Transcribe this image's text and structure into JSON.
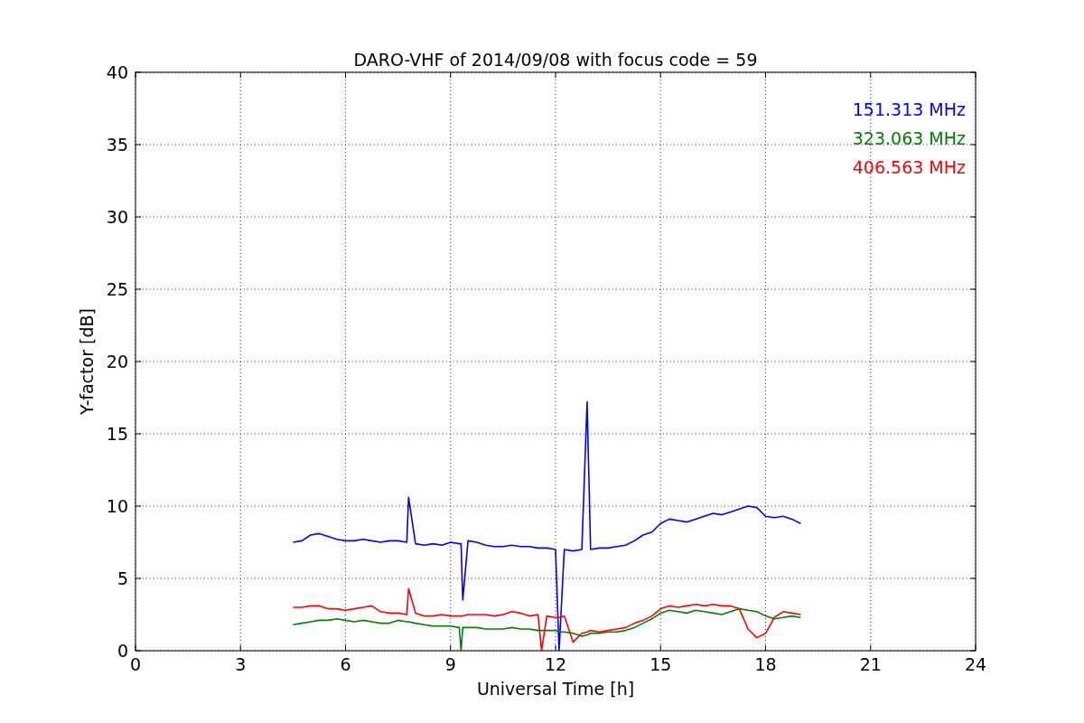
{
  "chart_data": {
    "type": "line",
    "title": "DARO-VHF of 2014/09/08 with focus code = 59",
    "xlabel": "Universal Time [h]",
    "ylabel": "Y-factor [dB]",
    "x": [
      4.5,
      4.75,
      5,
      5.25,
      5.5,
      5.75,
      6,
      6.25,
      6.5,
      6.75,
      7,
      7.25,
      7.5,
      7.75,
      7.8,
      8,
      8.25,
      8.5,
      8.75,
      9,
      9.25,
      9.3,
      9.35,
      9.5,
      9.75,
      10,
      10.25,
      10.5,
      10.75,
      11,
      11.25,
      11.5,
      11.6,
      11.75,
      12,
      12.1,
      12.25,
      12.5,
      12.75,
      12.9,
      13,
      13.25,
      13.5,
      13.75,
      14,
      14.25,
      14.5,
      14.75,
      15,
      15.25,
      15.5,
      15.75,
      16,
      16.25,
      16.5,
      16.75,
      17,
      17.25,
      17.5,
      17.75,
      18,
      18.25,
      18.5,
      18.75,
      19
    ],
    "series": [
      {
        "name": "151.313 MHz",
        "color": "#0000ff",
        "values": [
          7.5,
          7.6,
          8.0,
          8.1,
          7.9,
          7.7,
          7.6,
          7.6,
          7.7,
          7.6,
          7.5,
          7.6,
          7.6,
          7.5,
          10.6,
          7.4,
          7.3,
          7.4,
          7.3,
          7.5,
          7.4,
          7.4,
          3.5,
          7.6,
          7.5,
          7.3,
          7.2,
          7.2,
          7.3,
          7.2,
          7.2,
          7.1,
          7.1,
          7.1,
          7.0,
          0,
          7.0,
          6.9,
          7.0,
          17.2,
          7.0,
          7.1,
          7.1,
          7.2,
          7.3,
          7.6,
          8.0,
          8.2,
          8.8,
          9.1,
          9.0,
          8.9,
          9.1,
          9.3,
          9.5,
          9.4,
          9.6,
          9.8,
          10.0,
          9.9,
          9.3,
          9.2,
          9.3,
          9.1,
          8.8
        ]
      },
      {
        "name": "323.063 MHz",
        "color": "#008000",
        "values": [
          1.8,
          1.9,
          2.0,
          2.1,
          2.1,
          2.2,
          2.1,
          2.0,
          2.1,
          2.0,
          1.9,
          1.9,
          2.1,
          2.0,
          2.0,
          1.9,
          1.8,
          1.7,
          1.7,
          1.7,
          1.6,
          0,
          1.6,
          1.6,
          1.6,
          1.5,
          1.5,
          1.5,
          1.6,
          1.5,
          1.5,
          1.4,
          1.4,
          1.4,
          1.4,
          1.3,
          1.3,
          1.2,
          1.0,
          1.1,
          1.2,
          1.2,
          1.3,
          1.3,
          1.4,
          1.6,
          1.9,
          2.2,
          2.6,
          2.8,
          2.7,
          2.6,
          2.8,
          2.7,
          2.6,
          2.5,
          2.7,
          2.9,
          2.8,
          2.7,
          2.4,
          2.2,
          2.3,
          2.4,
          2.3
        ]
      },
      {
        "name": "406.563 MHz",
        "color": "#ff0000",
        "values": [
          3.0,
          3.0,
          3.1,
          3.1,
          2.9,
          2.9,
          2.8,
          2.9,
          3.0,
          3.1,
          2.7,
          2.6,
          2.6,
          2.5,
          4.3,
          2.6,
          2.4,
          2.4,
          2.5,
          2.4,
          2.4,
          2.4,
          2.4,
          2.5,
          2.5,
          2.5,
          2.4,
          2.5,
          2.7,
          2.6,
          2.4,
          2.5,
          0,
          2.4,
          2.3,
          2.3,
          2.4,
          0.6,
          1.2,
          1.3,
          1.4,
          1.3,
          1.4,
          1.5,
          1.6,
          1.9,
          2.1,
          2.4,
          2.9,
          3.1,
          3.0,
          3.1,
          3.2,
          3.1,
          3.2,
          3.1,
          3.1,
          2.9,
          1.5,
          0.9,
          1.2,
          2.3,
          2.7,
          2.6,
          2.5
        ]
      }
    ],
    "grid": true,
    "xlim": [
      0,
      24
    ],
    "ylim": [
      0,
      40
    ],
    "xticks": [
      0,
      3,
      6,
      9,
      12,
      15,
      18,
      21,
      24
    ],
    "yticks": [
      0,
      5,
      10,
      15,
      20,
      25,
      30,
      35,
      40
    ]
  }
}
